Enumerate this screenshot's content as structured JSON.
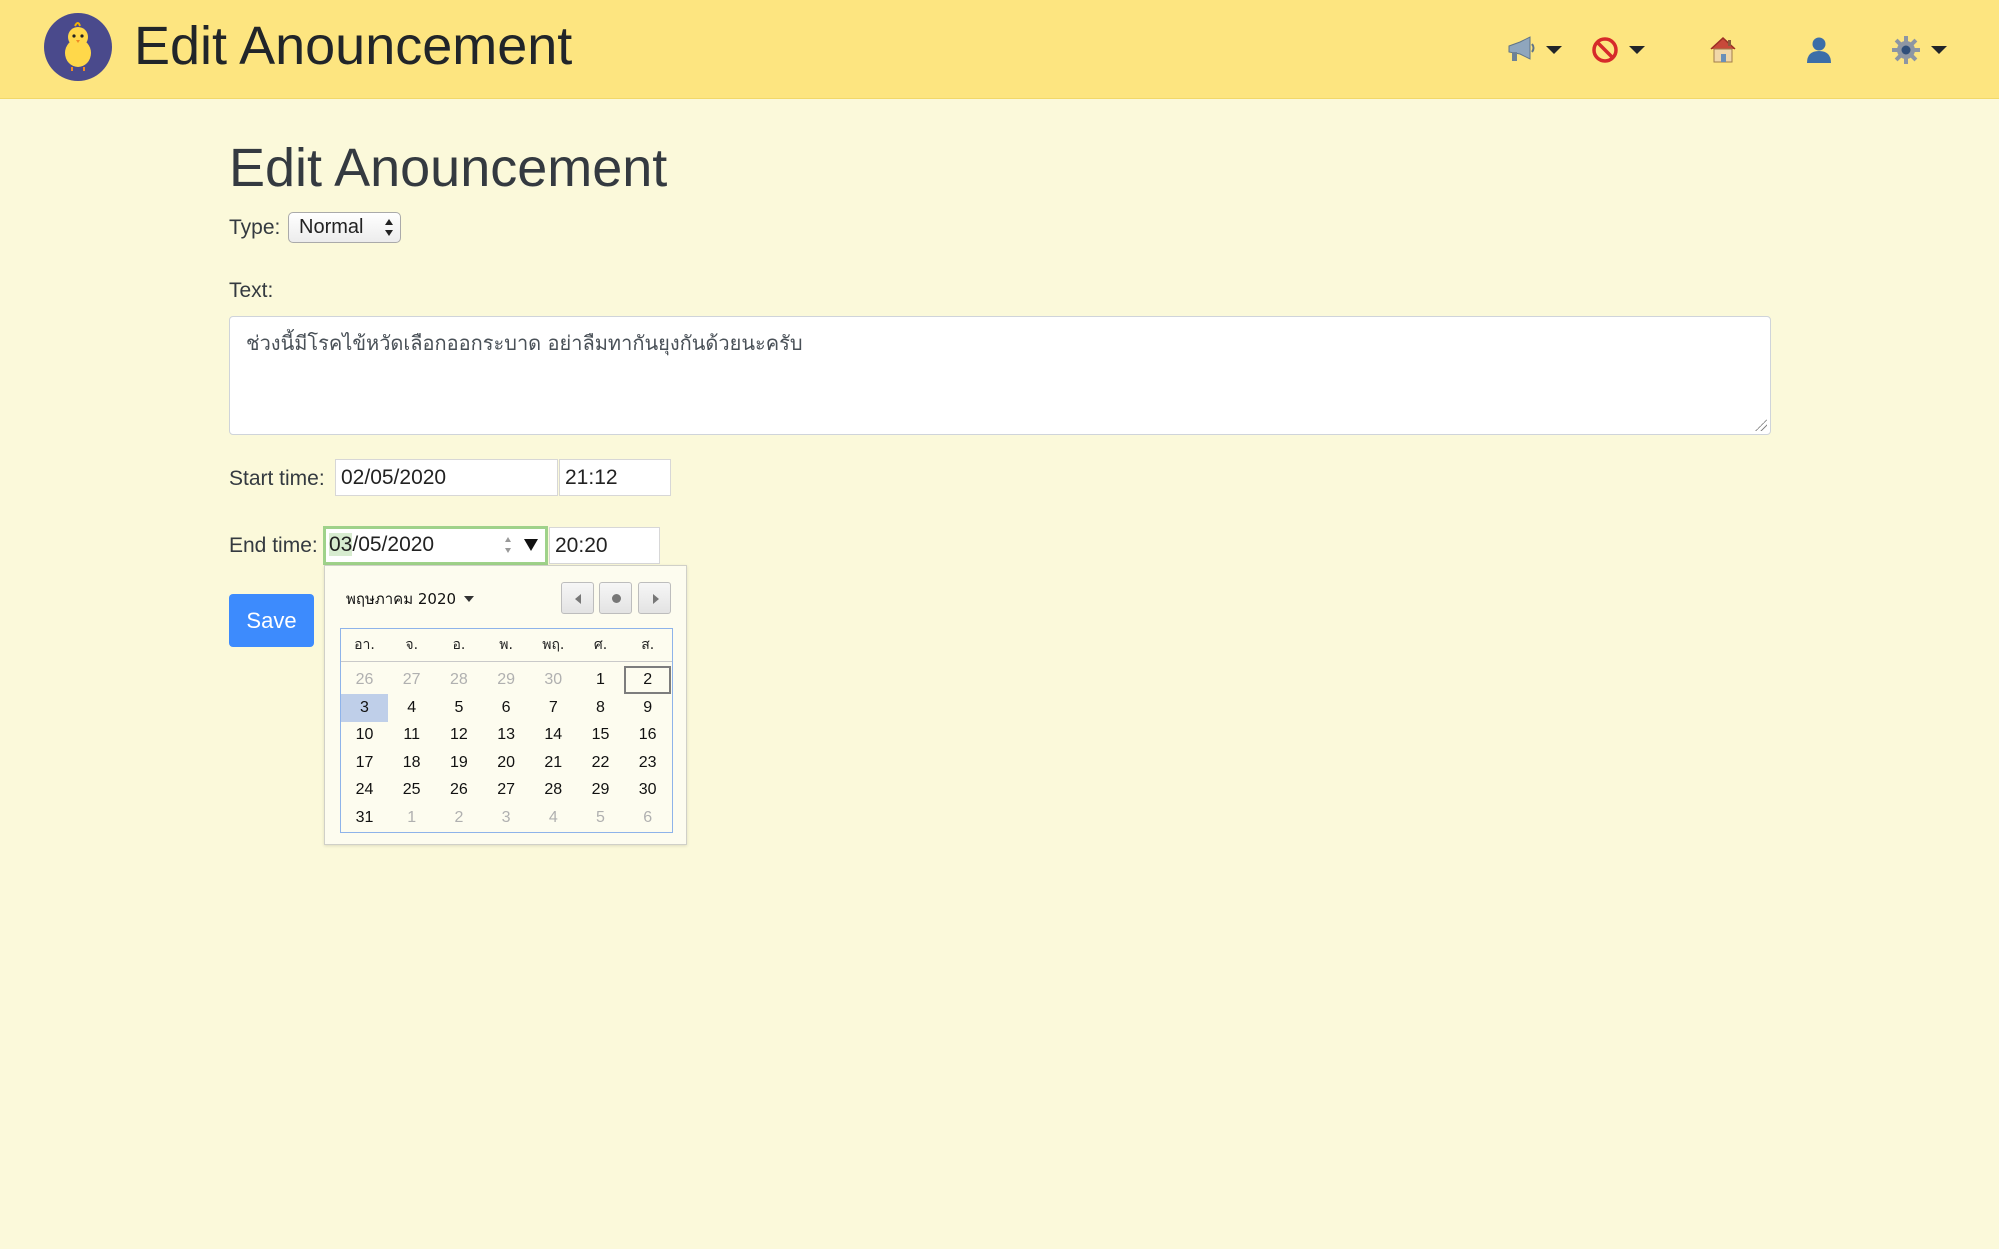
{
  "navbar": {
    "brand": "Edit Anouncement",
    "icons": [
      "announcement-icon",
      "blocked-icon",
      "home-icon",
      "user-icon",
      "settings-icon"
    ]
  },
  "page": {
    "title": "Edit Anouncement"
  },
  "form": {
    "type_label": "Type:",
    "type_value": "Normal",
    "text_label": "Text:",
    "text_value": "ช่วงนี้มีโรคไข้หวัดเลือกออกระบาด อย่าลืมทากันยุงกันด้วยนะครับ",
    "start_label": "Start time:",
    "start_date": "02/05/2020",
    "start_time": "21:12",
    "end_label": "End time:",
    "end_date_day": "03",
    "end_date_rest": "/05/2020",
    "end_time": "20:20",
    "save_label": "Save"
  },
  "calendar": {
    "month_label": "พฤษภาคม 2020",
    "weekdays": [
      "อา.",
      "จ.",
      "อ.",
      "พ.",
      "พฤ.",
      "ศ.",
      "ส."
    ],
    "weeks": [
      [
        {
          "d": "26",
          "o": true
        },
        {
          "d": "27",
          "o": true
        },
        {
          "d": "28",
          "o": true
        },
        {
          "d": "29",
          "o": true
        },
        {
          "d": "30",
          "o": true
        },
        {
          "d": "1"
        },
        {
          "d": "2",
          "today": true
        }
      ],
      [
        {
          "d": "3",
          "sel": true
        },
        {
          "d": "4"
        },
        {
          "d": "5"
        },
        {
          "d": "6"
        },
        {
          "d": "7"
        },
        {
          "d": "8"
        },
        {
          "d": "9"
        }
      ],
      [
        {
          "d": "10"
        },
        {
          "d": "11"
        },
        {
          "d": "12"
        },
        {
          "d": "13"
        },
        {
          "d": "14"
        },
        {
          "d": "15"
        },
        {
          "d": "16"
        }
      ],
      [
        {
          "d": "17"
        },
        {
          "d": "18"
        },
        {
          "d": "19"
        },
        {
          "d": "20"
        },
        {
          "d": "21"
        },
        {
          "d": "22"
        },
        {
          "d": "23"
        }
      ],
      [
        {
          "d": "24"
        },
        {
          "d": "25"
        },
        {
          "d": "26"
        },
        {
          "d": "27"
        },
        {
          "d": "28"
        },
        {
          "d": "29"
        },
        {
          "d": "30"
        }
      ],
      [
        {
          "d": "31"
        },
        {
          "d": "1",
          "o": true
        },
        {
          "d": "2",
          "o": true
        },
        {
          "d": "3",
          "o": true
        },
        {
          "d": "4",
          "o": true
        },
        {
          "d": "5",
          "o": true
        },
        {
          "d": "6",
          "o": true
        }
      ]
    ]
  },
  "colors": {
    "navbar_bg": "#fde580",
    "page_bg": "#fbf9da",
    "primary": "#3d8bfd",
    "selected_day": "#bfcfe9"
  }
}
